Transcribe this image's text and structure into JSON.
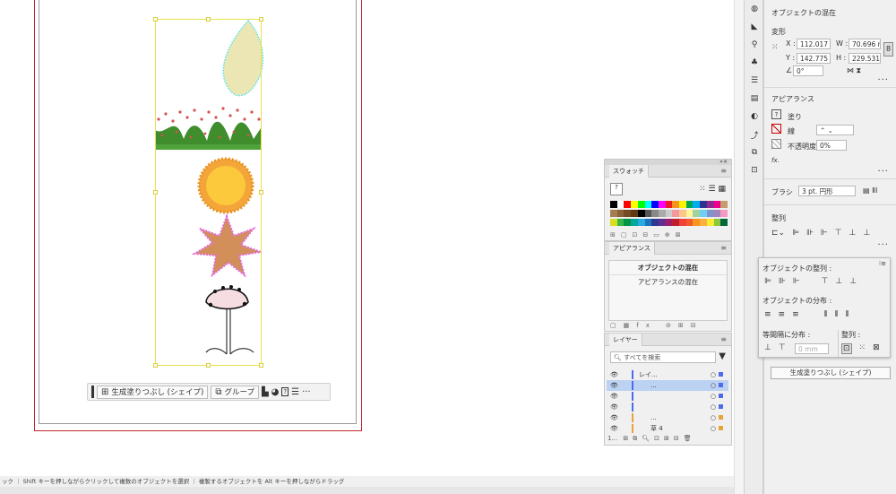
{
  "status_bar": {
    "text": "ック ｜ Shift キーを押しながらクリックして複数のオブジェクトを選択 ｜ 複製するオブジェクトを Alt キーを押しながらドラッグ"
  },
  "context_bar": {
    "generative_fill_label": "生成塗りつぶし (シェイプ)",
    "group_label": "グループ",
    "more_label": "···"
  },
  "swatches_panel": {
    "tab_label": "スウォッチ",
    "colors": [
      "#000000",
      "#ffffff",
      "#ff0000",
      "#ffff00",
      "#00ff00",
      "#00ffff",
      "#0000ff",
      "#ff00ff",
      "#ed1c24",
      "#f7941d",
      "#fff200",
      "#00a651",
      "#00aeef",
      "#2e3192",
      "#92278f",
      "#ec008c",
      "#c69c6d",
      "#a67c52",
      "#8c6239",
      "#754c24",
      "#603913",
      "#000000",
      "#555555",
      "#888888",
      "#aaaaaa",
      "#cccccc",
      "#f5989d",
      "#fdc689",
      "#fff799",
      "#a3d39c",
      "#6dcff6",
      "#8393ca",
      "#a186be",
      "#f49ac1",
      "#d7df23",
      "#39b54a",
      "#009444",
      "#00a99d",
      "#27aae1",
      "#1c75bc",
      "#2b3990",
      "#662d91",
      "#9e1f63",
      "#be1e2d",
      "#ef4136",
      "#f15a29",
      "#f7941e",
      "#fbb040",
      "#f9ed32",
      "#8dc63f",
      "#006838"
    ]
  },
  "appearance_panel": {
    "tab_label": "アピアランス",
    "row1": "オブジェクトの混在",
    "row2": "アピアランスの混在"
  },
  "layers_panel": {
    "tab_label": "レイヤー",
    "search_placeholder": "すべてを検索",
    "rows": [
      {
        "name": "レイ...",
        "color": "#4f6bed",
        "indent": 0,
        "selected": false
      },
      {
        "name": "...",
        "color": "#4f6bed",
        "indent": 1,
        "selected": true
      },
      {
        "name": "",
        "color": "#4f6bed",
        "indent": 2,
        "selected": false
      },
      {
        "name": "",
        "color": "#4f6bed",
        "indent": 3,
        "selected": false
      },
      {
        "name": "...",
        "color": "#e8a33a",
        "indent": 1,
        "selected": false
      },
      {
        "name": "草 4",
        "color": "#e8a33a",
        "indent": 1,
        "selected": false
      }
    ],
    "footer_count": "1..."
  },
  "properties_panel": {
    "title": "オブジェクトの混在",
    "transform_label": "変形",
    "x_label": "X :",
    "x_value": "112.017",
    "y_label": "Y :",
    "y_value": "142.775",
    "w_label": "W :",
    "w_value": "70.696 r",
    "h_label": "H :",
    "h_value": "229.531",
    "angle_value": "0°",
    "appearance_label": "アピアランス",
    "fill_label": "塗り",
    "stroke_label": "線",
    "opacity_label": "不透明度",
    "opacity_value": "0%",
    "fx_label": "fx.",
    "brush_label": "ブラシ",
    "brush_value": "3 pt. 円形",
    "align_label": "整列",
    "generative_fill_button": "生成塗りつぶし (シェイプ)"
  },
  "align_popover": {
    "object_align_label": "オブジェクトの整列 :",
    "object_distribute_label": "オブジェクトの分布 :",
    "distribute_spacing_label": "等間隔に分布 :",
    "align_to_label": "整列 :",
    "spacing_value": "0 mm"
  }
}
